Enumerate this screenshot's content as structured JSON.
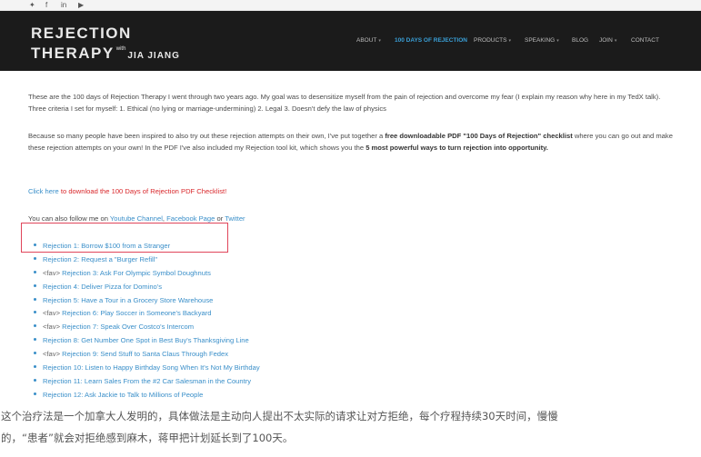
{
  "social": {
    "icons": [
      "twitter-icon",
      "facebook-icon",
      "linkedin-icon",
      "youtube-icon"
    ],
    "glyphs": [
      "🐦",
      "f",
      "in",
      "▶"
    ]
  },
  "header": {
    "logo_line1": "REJECTION",
    "logo_line2": "THERAPY",
    "logo_with": "with",
    "logo_name": "JIA JIANG",
    "nav": [
      {
        "label": "ABOUT",
        "caret": true,
        "active": false
      },
      {
        "label": "100 DAYS OF REJECTION",
        "caret": false,
        "active": true
      },
      {
        "label": "PRODUCTS",
        "caret": true,
        "active": false
      },
      {
        "label": "SPEAKING",
        "caret": true,
        "active": false
      },
      {
        "label": "BLOG",
        "caret": false,
        "active": false
      },
      {
        "label": "JOIN",
        "caret": true,
        "active": false
      },
      {
        "label": "CONTACT",
        "caret": false,
        "active": false
      }
    ]
  },
  "intro": {
    "p1": "These are the 100 days of Rejection Therapy I went through two years ago. My goal was to desensitize myself from the pain of rejection and overcome my fear (I explain my reason why here in my TedX talk). Three criteria I set for myself: 1. Ethical (no lying or marriage-undermining) 2. Legal 3. Doesn't defy the law of physics",
    "p2_a": "Because so many people have been inspired to also try out these rejection attempts on their own, I've put together a ",
    "p2_bold1": "free downloadable PDF \"100 Days of Rejection\" checklist",
    "p2_b": " where you can go out and make these rejection attempts on your own! In the PDF I've also included my Rejection tool kit, which shows you the ",
    "p2_bold2": "5 most powerful ways to turn rejection into opportunity.",
    "click_here": "Click here",
    "download_text": " to download the 100 Days of Rejection PDF Checklist!",
    "follow_a": "You can also follow me on ",
    "follow_youtube": "Youtube Channel",
    "follow_sep": ", ",
    "follow_facebook": "Facebook Page",
    "follow_or": " or ",
    "follow_twitter": "Twitter"
  },
  "rejections": [
    {
      "fav": "",
      "title": "Rejection 1: Borrow $100 from a Stranger"
    },
    {
      "fav": "",
      "title": "Rejection 2: Request a \"Burger Refill\""
    },
    {
      "fav": "<fav>",
      "title": "Rejection 3: Ask For Olympic Symbol Doughnuts"
    },
    {
      "fav": "",
      "title": "Rejection 4: Deliver Pizza for Domino's"
    },
    {
      "fav": "",
      "title": "Rejection 5: Have a Tour in a Grocery Store Warehouse"
    },
    {
      "fav": "<fav>",
      "title": "Rejection 6: Play Soccer in Someone's Backyard"
    },
    {
      "fav": "<fav>",
      "title": "Rejection 7: Speak Over Costco's Intercom"
    },
    {
      "fav": "",
      "title": "Rejection 8: Get Number One Spot in Best Buy's Thanksgiving Line"
    },
    {
      "fav": "<fav>",
      "title": "Rejection 9: Send Stuff to Santa Claus Through Fedex"
    },
    {
      "fav": "",
      "title": "Rejection 10: Listen to Happy Birthday Song When It's Not My Birthday"
    },
    {
      "fav": "",
      "title": "Rejection 11: Learn Sales From the #2 Car Salesman in the Country"
    },
    {
      "fav": "",
      "title": "Rejection 12: Ask Jackie to Talk to Millions of People"
    }
  ],
  "caption": {
    "line1": "这个治疗法是一个加拿大人发明的，具体做法是主动向人提出不太实际的请求让对方拒绝，每个疗程持续30天时间，慢慢",
    "line2": "的，“患者”就会对拒绝感到麻木，蒋甲把计划延长到了100天。"
  },
  "colors": {
    "header_bg": "#1b1b1b",
    "link": "#3a8fc9",
    "accent_red": "#d9272b",
    "highlight_box": "#e0455a"
  }
}
